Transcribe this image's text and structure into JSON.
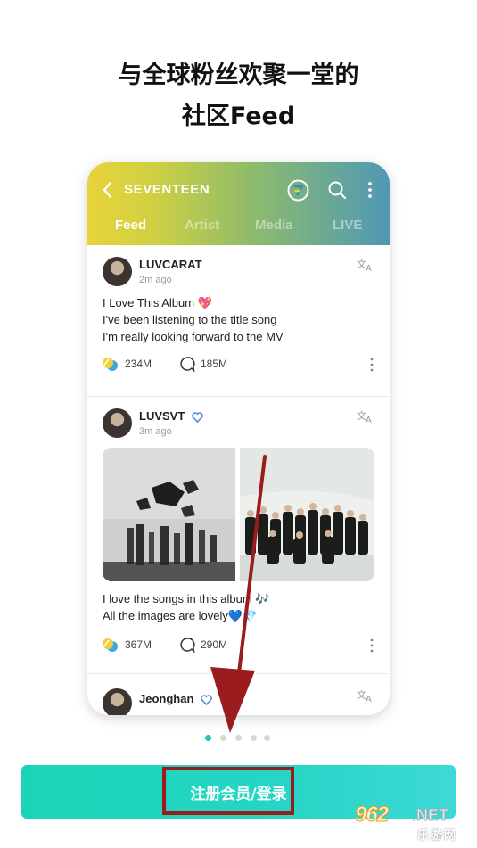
{
  "headline": {
    "line1": "与全球粉丝欢聚一堂的",
    "line2": "社区Feed"
  },
  "app": {
    "title": "SEVENTEEN",
    "tabs": [
      {
        "label": "Feed",
        "active": true
      },
      {
        "label": "Artist",
        "active": false
      },
      {
        "label": "Media",
        "active": false
      },
      {
        "label": "LIVE",
        "active": false
      }
    ],
    "header_gradient": [
      "#e8d33a",
      "#8dbb6c",
      "#4f98b6"
    ]
  },
  "posts": [
    {
      "username": "LUVCARAT",
      "time": "2m ago",
      "verified": false,
      "lines": [
        "I Love This Album 💖",
        "I've been listening to the title song",
        "I'm really looking forward to the MV"
      ],
      "likes": "234M",
      "comments": "185M"
    },
    {
      "username": "LUVSVT",
      "time": "3m ago",
      "verified": true,
      "lines": [
        "I love the songs in this album 🎶",
        "All the images are lovely💙💎"
      ],
      "likes": "367M",
      "comments": "290M"
    },
    {
      "username": "Jeonghan",
      "verified": true
    }
  ],
  "pagination": {
    "total": 5,
    "active": 0
  },
  "signup": {
    "label": "注册会员/登录"
  },
  "watermark": {
    "num": "962",
    "net": ".NET",
    "cn": "乐游网"
  },
  "colors": {
    "accent": "#1ec8b8",
    "highlight": "#9b1c1c"
  },
  "icons": [
    "back-arrow-icon",
    "brand-logo-icon",
    "search-icon",
    "more-vert-icon",
    "translate-icon",
    "like-reaction-icon",
    "comment-icon",
    "verified-heart-icon"
  ]
}
